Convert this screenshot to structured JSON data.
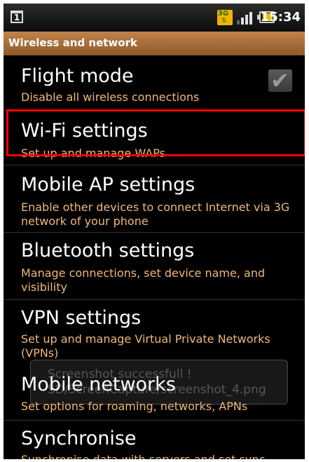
{
  "status_bar": {
    "network_badge": "3G",
    "time": "15:34",
    "left_icon": "notification-icon",
    "icons": [
      "3g-data-icon",
      "signal-icon",
      "battery-icon"
    ]
  },
  "header": {
    "title": "Wireless and network"
  },
  "settings": [
    {
      "title": "Flight mode",
      "summary": "Disable all wireless connections",
      "checked": true
    },
    {
      "title": "Wi-Fi settings",
      "summary": "Set up and manage WAPs"
    },
    {
      "title": "Mobile AP settings",
      "summary": "Enable other devices to connect Internet via 3G network of your phone"
    },
    {
      "title": "Bluetooth settings",
      "summary": "Manage connections, set device name, and visibility"
    },
    {
      "title": "VPN settings",
      "summary": "Set up and manage Virtual Private Networks (VPNs)"
    },
    {
      "title": "Mobile networks",
      "summary": "Set options for roaming, networks, APNs"
    },
    {
      "title": "Synchronise",
      "summary": "Synchronise data with servers and set sync"
    }
  ],
  "toast": {
    "line1": "Screenshot successfull !",
    "line2": "SD/ScreenCapture/screenshot_4.png"
  },
  "colors": {
    "accent_header": "#b07a44",
    "summary_text": "#f0b878",
    "highlight": "#ff0000"
  }
}
